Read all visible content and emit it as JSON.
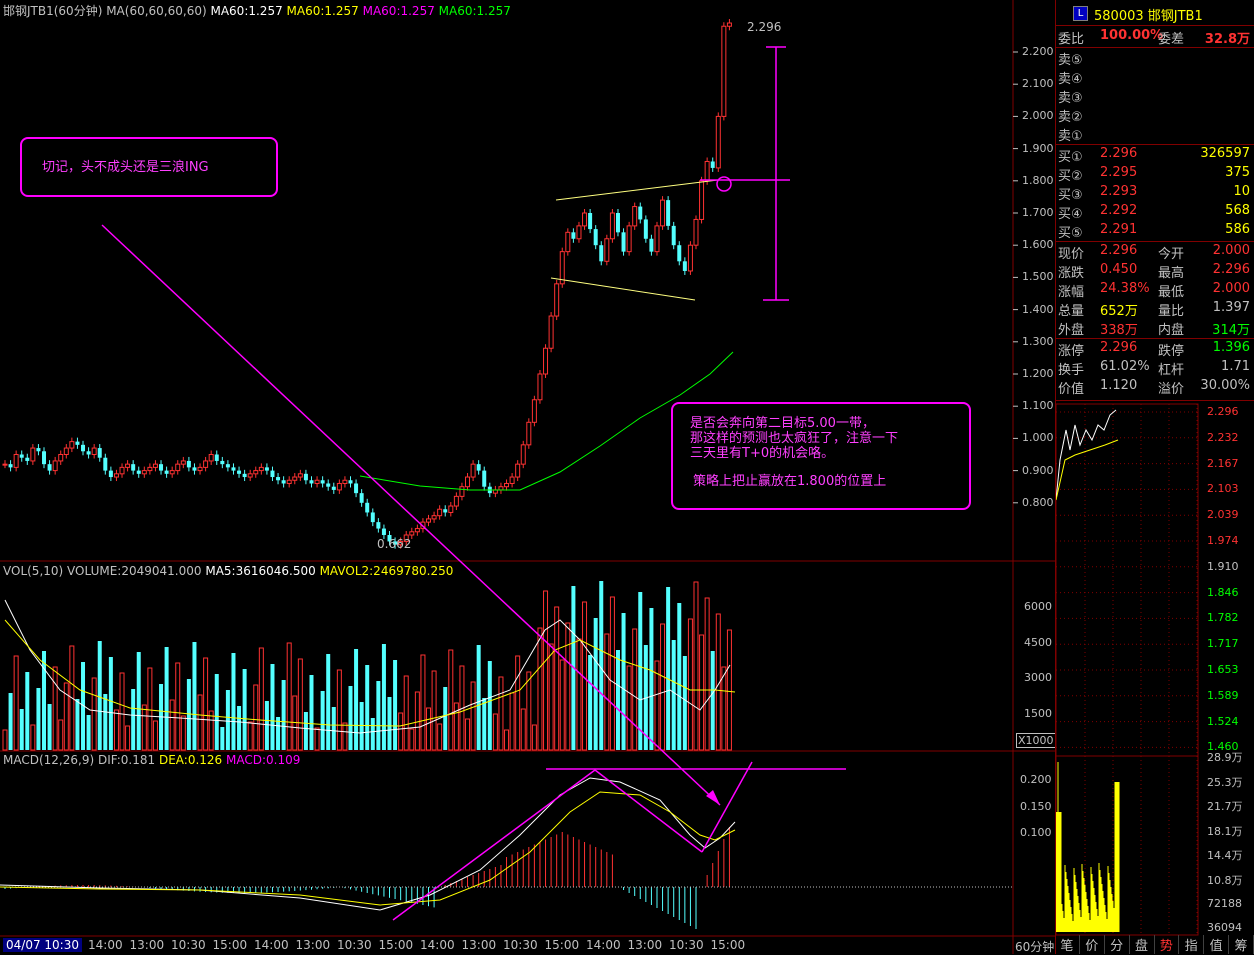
{
  "main_header": {
    "title": "邯钢JTB1(60分钟)",
    "ma_settings": "MA(60,60,60,60)",
    "ma1": "MA60:1.257",
    "ma2": "MA60:1.257",
    "ma3": "MA60:1.257",
    "ma4": "MA60:1.257"
  },
  "price_axis": [
    "2.200",
    "2.100",
    "2.000",
    "1.900",
    "1.800",
    "1.700",
    "1.600",
    "1.500",
    "1.400",
    "1.300",
    "1.200",
    "1.100",
    "1.000",
    "0.900",
    "0.800"
  ],
  "price_annotations": {
    "high": "2.296",
    "low": "0.662"
  },
  "vol_header": {
    "label": "VOL(5,10)",
    "volume": "VOLUME:2049041.000",
    "ma5": "MA5:3616046.500",
    "mavol2": "MAVOL2:2469780.250"
  },
  "vol_axis": [
    "6000",
    "4500",
    "3000",
    "1500"
  ],
  "vol_unit": "X1000",
  "macd_header": {
    "label": "MACD(12,26,9)",
    "dif": "DIF:0.181",
    "dea": "DEA:0.126",
    "macd": "MACD:0.109"
  },
  "macd_axis": [
    "0.200",
    "0.150",
    "0.100"
  ],
  "time_axis": {
    "first": "04/07 10:30",
    "labels": [
      "14:00",
      "13:00",
      "10:30",
      "15:00",
      "14:00",
      "13:00",
      "10:30",
      "15:00",
      "14:00",
      "13:00",
      "10:30",
      "15:00",
      "14:00",
      "13:00",
      "10:30",
      "15:00"
    ]
  },
  "period_label": "60分钟",
  "annotations": {
    "note1": "切记，头不成头还是三浪ING",
    "note2_line1": "是否会奔向第二目标5.00一带，",
    "note2_line2": "那这样的预测也太疯狂了，注意一下",
    "note2_line3": "三天里有T+0的机会咯。",
    "note2_line4": "策略上把止赢放在1.800的位置上"
  },
  "quote": {
    "code": "580003",
    "name": "邯钢JTB1",
    "weibi_label": "委比",
    "weibi_value": "100.00%",
    "weicha_label": "委差",
    "weicha_value": "32.8万",
    "sell": [
      {
        "label": "卖⑤",
        "price": "",
        "vol": ""
      },
      {
        "label": "卖④",
        "price": "",
        "vol": ""
      },
      {
        "label": "卖③",
        "price": "",
        "vol": ""
      },
      {
        "label": "卖②",
        "price": "",
        "vol": ""
      },
      {
        "label": "卖①",
        "price": "",
        "vol": ""
      }
    ],
    "buy": [
      {
        "label": "买①",
        "price": "2.296",
        "vol": "326597"
      },
      {
        "label": "买②",
        "price": "2.295",
        "vol": "375"
      },
      {
        "label": "买③",
        "price": "2.293",
        "vol": "10"
      },
      {
        "label": "买④",
        "price": "2.292",
        "vol": "568"
      },
      {
        "label": "买⑤",
        "price": "2.291",
        "vol": "586"
      }
    ],
    "stats": [
      {
        "l1": "现价",
        "v1": "2.296",
        "l2": "今开",
        "v2": "2.000"
      },
      {
        "l1": "涨跌",
        "v1": "0.450",
        "l2": "最高",
        "v2": "2.296"
      },
      {
        "l1": "涨幅",
        "v1": "24.38%",
        "l2": "最低",
        "v2": "2.000"
      },
      {
        "l1": "总量",
        "v1": "652万",
        "l2": "量比",
        "v2": "1.397"
      },
      {
        "l1": "外盘",
        "v1": "338万",
        "l2": "内盘",
        "v2": "314万"
      }
    ],
    "stats2": [
      {
        "l1": "涨停",
        "v1": "2.296",
        "l2": "跌停",
        "v2": "1.396"
      },
      {
        "l1": "换手",
        "v1": "61.02%",
        "l2": "杠杆",
        "v2": "1.71"
      },
      {
        "l1": "价值",
        "v1": "1.120",
        "l2": "溢价",
        "v2": "30.00%"
      }
    ]
  },
  "mini_price_axis": [
    "2.296",
    "2.232",
    "2.167",
    "2.103",
    "2.039",
    "1.974",
    "1.910",
    "1.846",
    "1.782",
    "1.717",
    "1.653",
    "1.589",
    "1.524",
    "1.460"
  ],
  "mini_vol_axis": [
    "28.9万",
    "25.3万",
    "21.7万",
    "18.1万",
    "14.4万",
    "10.8万",
    "72188",
    "36094"
  ],
  "bottom_tabs": [
    "笔",
    "价",
    "分",
    "盘",
    "势",
    "指",
    "值",
    "筹"
  ],
  "colors": {
    "up": "#ff3232",
    "down": "#54ffff",
    "ma": "#00ff00",
    "annotation": "#ff00ff",
    "grid": "#800000",
    "text": "#c0c0c0",
    "yellow": "#ffff00"
  }
}
